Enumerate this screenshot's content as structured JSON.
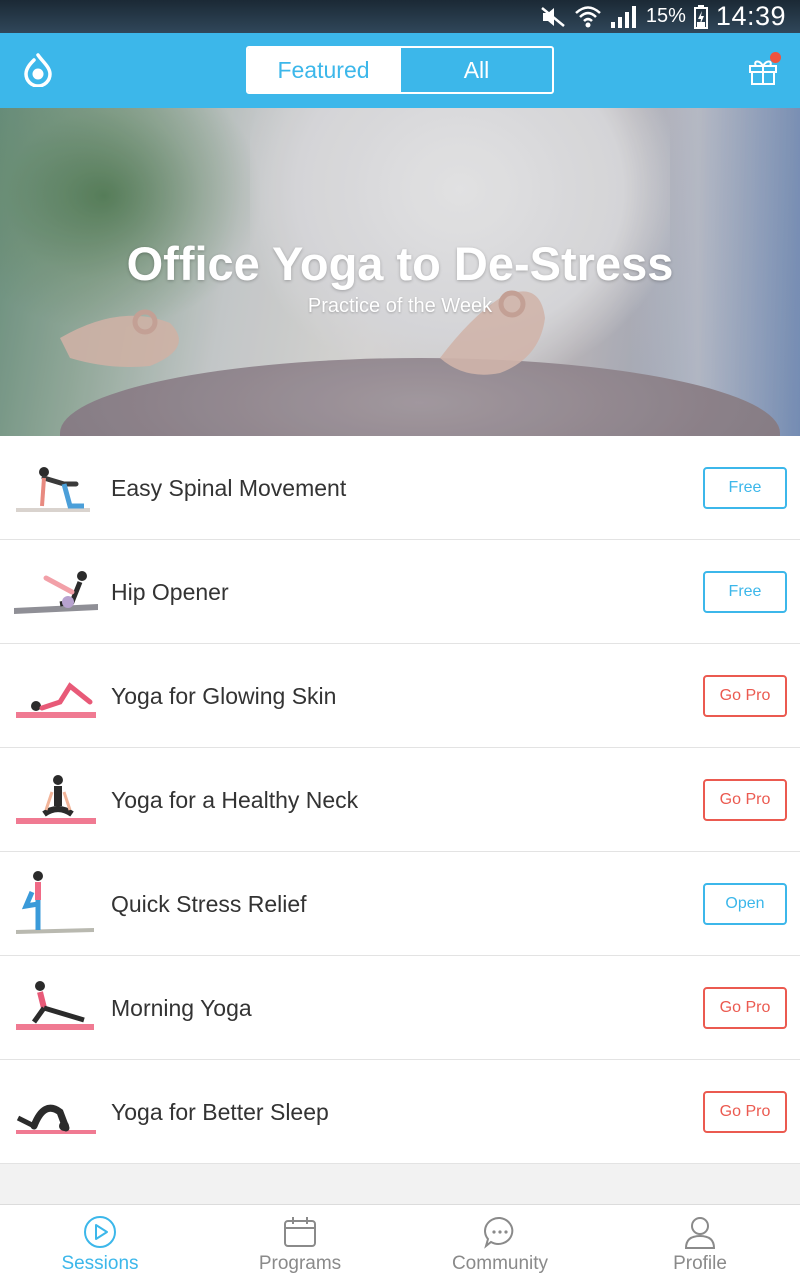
{
  "status_bar": {
    "battery_percent": "15%",
    "time": "14:39"
  },
  "app_bar": {
    "logo_icon": "app-logo-drop-icon",
    "segments": [
      {
        "label": "Featured",
        "selected": true
      },
      {
        "label": "All",
        "selected": false
      }
    ],
    "gift_icon": "gift-icon",
    "notification_dot_color": "#f0533e"
  },
  "hero": {
    "title": "Office Yoga to De-Stress",
    "subtitle": "Practice of the Week"
  },
  "sessions": [
    {
      "title": "Easy Spinal Movement",
      "badge": "Free",
      "badge_style": "blue",
      "mat_color": "#d9d3ce"
    },
    {
      "title": "Hip Opener",
      "badge": "Free",
      "badge_style": "blue",
      "mat_color": "#8f8f96"
    },
    {
      "title": "Yoga for Glowing Skin",
      "badge": "Go Pro",
      "badge_style": "red",
      "mat_color": "#f07a92"
    },
    {
      "title": "Yoga for a Healthy Neck",
      "badge": "Go Pro",
      "badge_style": "red",
      "mat_color": "#f07a92"
    },
    {
      "title": "Quick Stress Relief",
      "badge": "Open",
      "badge_style": "blue",
      "mat_color": "#b9b9b0"
    },
    {
      "title": "Morning Yoga",
      "badge": "Go Pro",
      "badge_style": "red",
      "mat_color": "#f07a92"
    },
    {
      "title": "Yoga for Better Sleep",
      "badge": "Go Pro",
      "badge_style": "red",
      "mat_color": "#f07a92"
    }
  ],
  "bottom_nav": [
    {
      "label": "Sessions",
      "icon": "play-circle-icon",
      "active": true
    },
    {
      "label": "Programs",
      "icon": "calendar-icon",
      "active": false
    },
    {
      "label": "Community",
      "icon": "chat-bubble-icon",
      "active": false
    },
    {
      "label": "Profile",
      "icon": "person-icon",
      "active": false
    }
  ],
  "colors": {
    "accent": "#3cb7ea",
    "pro_red": "#eb5a50"
  }
}
